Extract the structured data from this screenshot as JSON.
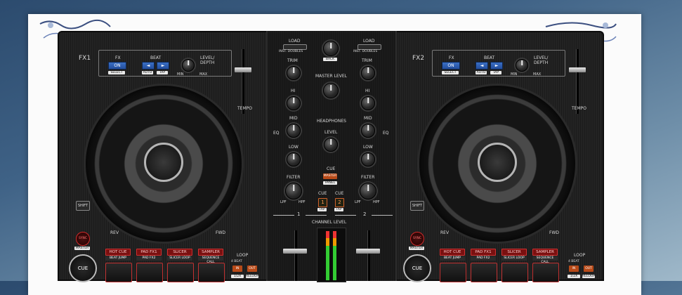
{
  "deck1": {
    "fx_label": "FX1",
    "fx": "FX",
    "fx_on": "ON",
    "select": "SELECT",
    "beat": "BEAT",
    "beat_left": "◄",
    "beat_right": "►",
    "auto": "AUTO",
    "tap": "TAP",
    "level_depth": "LEVEL/\nDEPTH",
    "min": "MIN",
    "max": "MAX",
    "tempo": "TEMPO",
    "shift": "SHIFT",
    "sync": "SYNC",
    "master": "MASTER",
    "cue": "CUE",
    "rev": "REV",
    "fwd": "FWD",
    "pad_modes": [
      "HOT CUE",
      "PAD FX1",
      "SLICER",
      "SAMPLER"
    ],
    "pad_sub_modes": [
      "BEAT JUMP",
      "PAD FX2",
      "SLICER LOOP",
      "SEQUENCE CALL"
    ],
    "loop": "LOOP",
    "in": "IN",
    "out": "OUT",
    "beat4": "4 BEAT",
    "loop_half": "1/2X",
    "reloop": "RELOOP"
  },
  "deck2": {
    "fx_label": "FX2",
    "fx": "FX",
    "fx_on": "ON",
    "select": "SELECT",
    "beat": "BEAT",
    "beat_left": "◄",
    "beat_right": "►",
    "auto": "AUTO",
    "tap": "TAP",
    "level_depth": "LEVEL/\nDEPTH",
    "min": "MIN",
    "max": "MAX",
    "tempo": "TEMPO",
    "shift": "SHIFT",
    "sync": "SYNC",
    "master": "MASTER",
    "cue": "CUE",
    "rev": "REV",
    "fwd": "FWD",
    "pad_modes": [
      "HOT CUE",
      "PAD FX1",
      "SLICER",
      "SAMPLER"
    ],
    "pad_sub_modes": [
      "BEAT JUMP",
      "PAD FX2",
      "SLICER LOOP",
      "SEQUENCE CALL"
    ],
    "loop": "LOOP",
    "in": "IN",
    "out": "OUT",
    "beat4": "4 BEAT",
    "loop_half": "1/2X",
    "reloop": "RELOOP"
  },
  "mixer": {
    "load": "LOAD",
    "inst_doubles": "INST. DOUBLES",
    "back": "BACK",
    "trim": "TRIM",
    "hi": "HI",
    "mid": "MID",
    "low": "LOW",
    "eq": "EQ",
    "filter": "FILTER",
    "lpf": "LPF",
    "hpf": "HPF",
    "master_level": "MASTER LEVEL",
    "headphones": "HEADPHONES",
    "level": "LEVEL",
    "cue": "CUE",
    "master_btn": "MASTER",
    "panel": "PANEL",
    "cue1": "1",
    "cue2": "2",
    "tap": "TAP",
    "ch1": "1",
    "ch2": "2",
    "channel_level": "CHANNEL LEVEL"
  },
  "colors": {
    "accent_blue": "#2a5bb0",
    "accent_red": "#d03030",
    "accent_orange": "#b84a18",
    "page_bg": "#fbfbfb"
  }
}
